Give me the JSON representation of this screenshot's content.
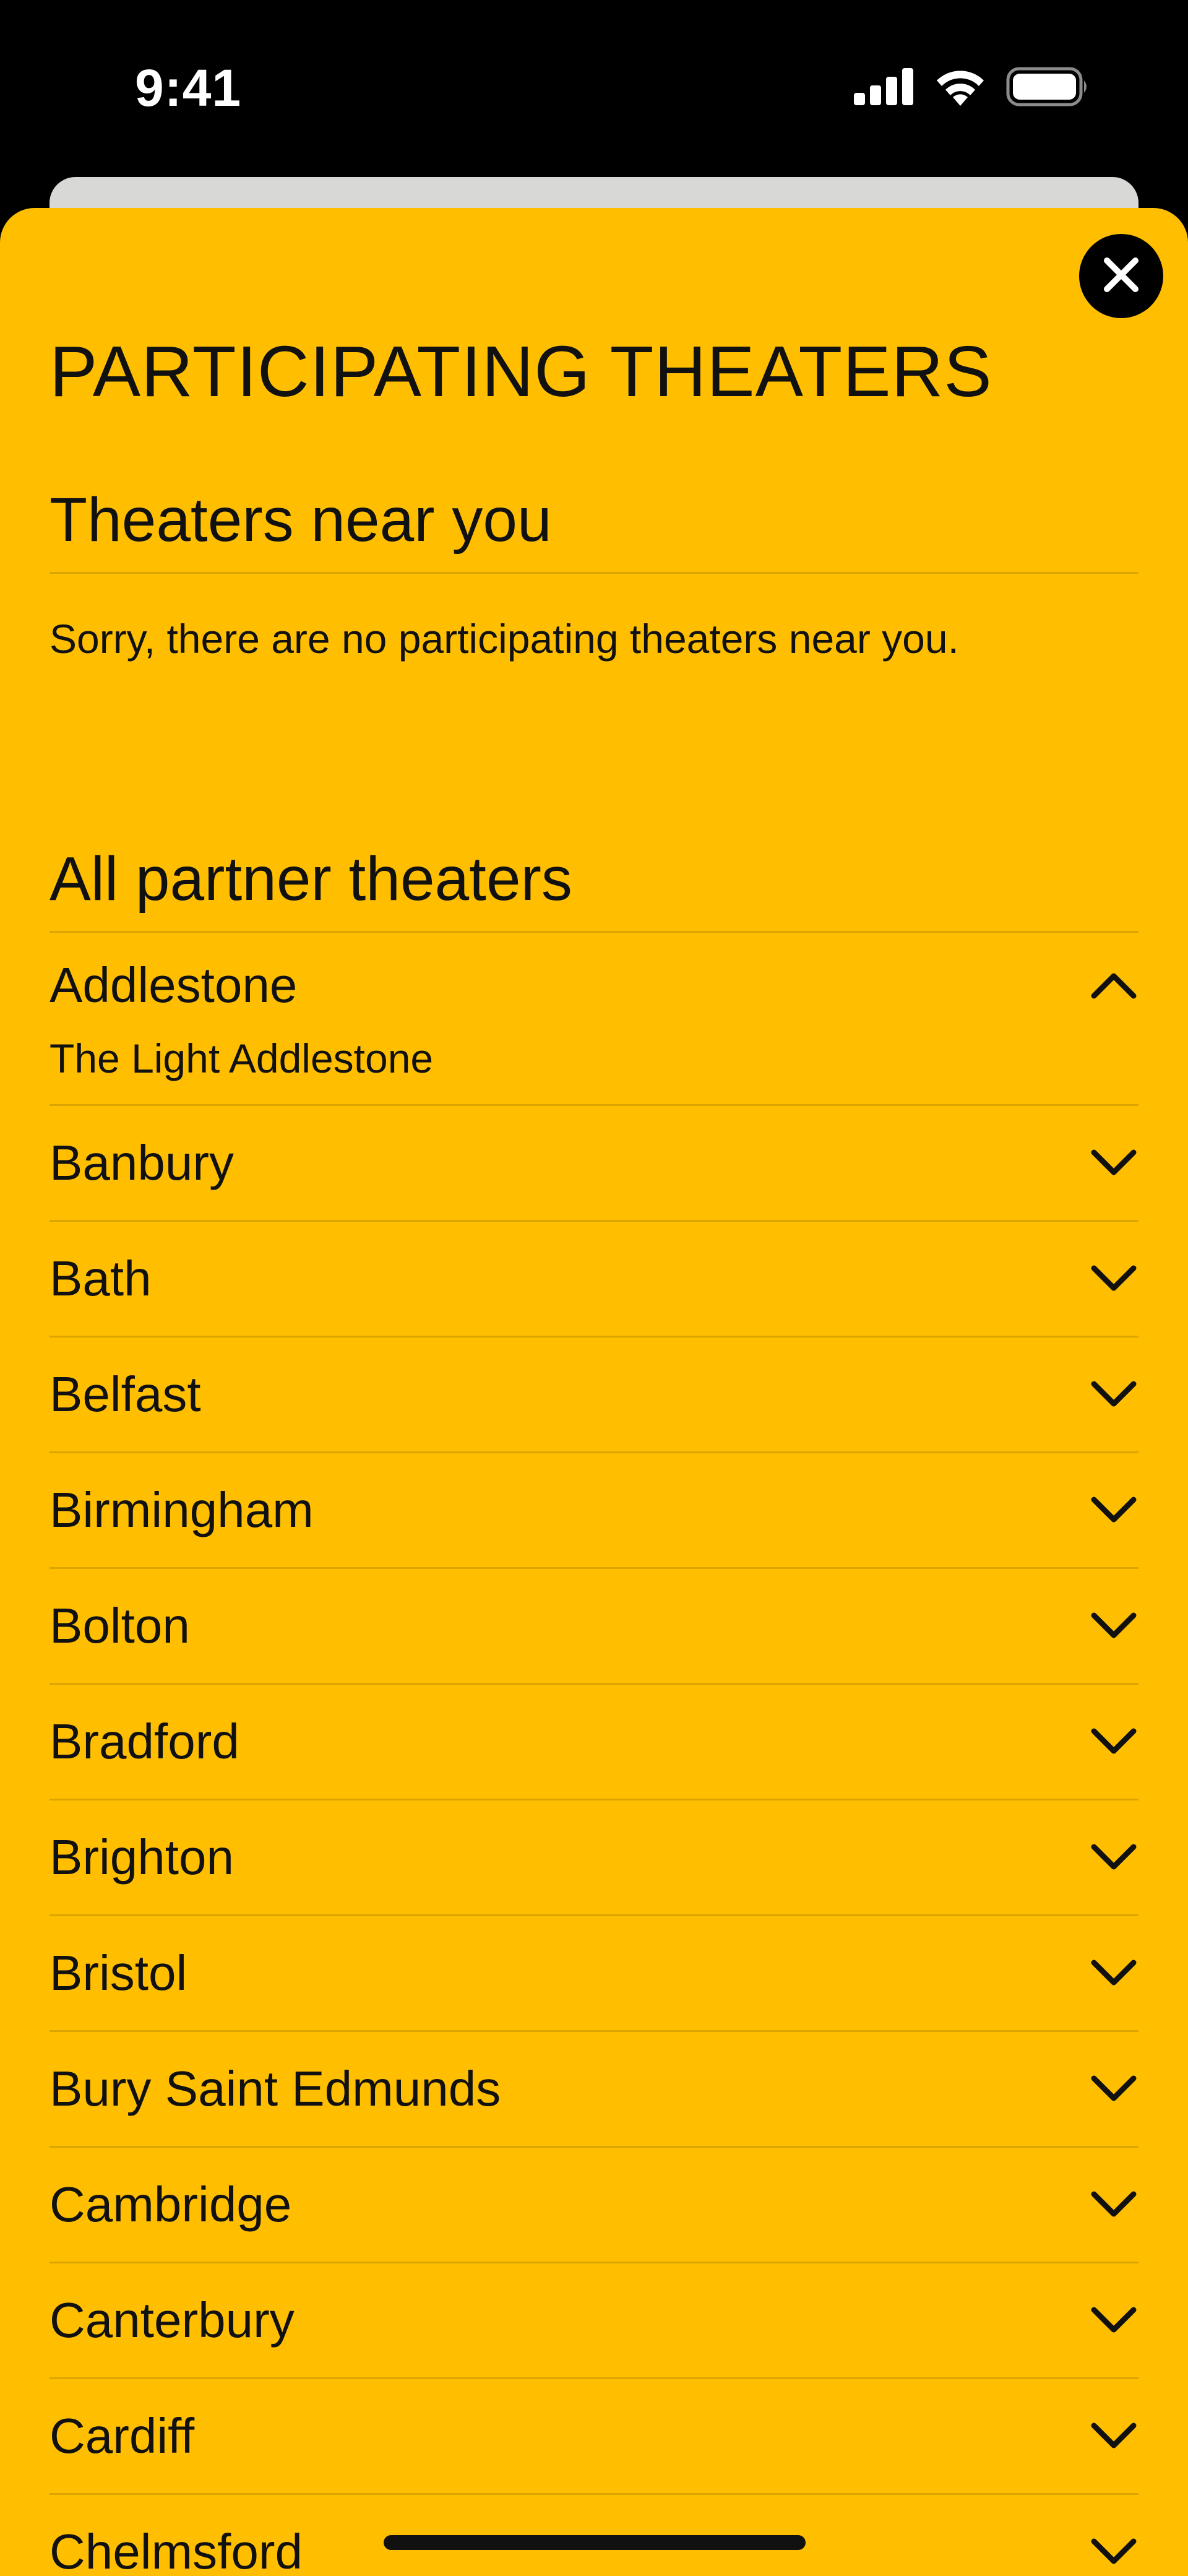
{
  "status_bar": {
    "time": "9:41"
  },
  "sheet": {
    "title": "PARTICIPATING THEATERS",
    "near_you": {
      "heading": "Theaters near you",
      "empty_message": "Sorry, there are no participating theaters near you."
    },
    "all_partners": {
      "heading": "All partner theaters",
      "cities": [
        {
          "name": "Addlestone",
          "expanded": true,
          "theaters": [
            "The Light Addlestone"
          ]
        },
        {
          "name": "Banbury",
          "expanded": false
        },
        {
          "name": "Bath",
          "expanded": false
        },
        {
          "name": "Belfast",
          "expanded": false
        },
        {
          "name": "Birmingham",
          "expanded": false
        },
        {
          "name": "Bolton",
          "expanded": false
        },
        {
          "name": "Bradford",
          "expanded": false
        },
        {
          "name": "Brighton",
          "expanded": false
        },
        {
          "name": "Bristol",
          "expanded": false
        },
        {
          "name": "Bury Saint Edmunds",
          "expanded": false
        },
        {
          "name": "Cambridge",
          "expanded": false
        },
        {
          "name": "Canterbury",
          "expanded": false
        },
        {
          "name": "Cardiff",
          "expanded": false
        },
        {
          "name": "Chelmsford",
          "expanded": false
        }
      ]
    }
  },
  "icons": {
    "close": "close-icon",
    "expand": "chevron-down-icon",
    "collapse": "chevron-up-icon",
    "signal": "cellular-signal-icon",
    "wifi": "wifi-icon",
    "battery": "battery-icon"
  },
  "colors": {
    "sheet_background": "#ffbf00",
    "text": "#111111",
    "status_background": "#000000",
    "backdrop_card": "#d8d8d6"
  }
}
